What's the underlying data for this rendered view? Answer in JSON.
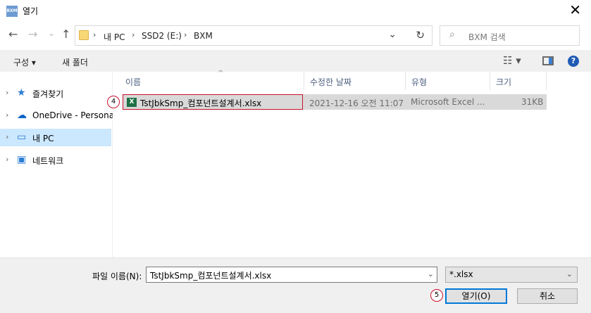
{
  "window": {
    "title": "열기",
    "app_icon_text": "BXM",
    "close_glyph": "✕"
  },
  "nav": {
    "back_glyph": "←",
    "forward_glyph": "→",
    "recent_glyph": "⌄",
    "up_glyph": "↑",
    "breadcrumbs": [
      "내 PC",
      "SSD2 (E:)",
      "BXM"
    ],
    "crumb_sep": "›",
    "dropdown_glyph": "⌄",
    "refresh_glyph": "↻",
    "search_placeholder": "BXM 검색",
    "search_glyph": "⌕"
  },
  "toolbar": {
    "organize": "구성 ▾",
    "new_folder": "새 폴더",
    "view_glyph": "☷ ▾",
    "help_glyph": "?"
  },
  "sidebar": {
    "items": [
      {
        "label": "즐겨찾기",
        "icon": "star-icon",
        "glyph": "★",
        "color": "#2b7cd3"
      },
      {
        "label": "OneDrive - Personal",
        "icon": "cloud-icon",
        "glyph": "☁",
        "color": "#0a64c8"
      },
      {
        "label": "내 PC",
        "icon": "computer-icon",
        "glyph": "▭",
        "color": "#2b7cd3"
      },
      {
        "label": "네트워크",
        "icon": "network-icon",
        "glyph": "▣",
        "color": "#2b7cd3"
      }
    ],
    "chevron": "›"
  },
  "columns": {
    "name": "이름",
    "modified": "수정한 날짜",
    "type": "유형",
    "size": "크기",
    "sort_glyph": "^"
  },
  "files": [
    {
      "name": "TstJbkSmp_컴포넌트설계서.xlsx",
      "modified": "2021-12-16 오전 11:07",
      "type": "Microsoft Excel ...",
      "size": "31KB",
      "icon_text": "X"
    }
  ],
  "steps": {
    "file_marker": "4",
    "open_marker": "5"
  },
  "footer": {
    "filename_label": "파일 이름(N):",
    "filename_value": "TstJbkSmp_컴포넌트설계서.xlsx",
    "filetype_value": "*.xlsx",
    "dropdown_glyph": "⌄",
    "open_button": "열기(O)",
    "cancel_button": "취소"
  },
  "colors": {
    "selection": "#cce8ff",
    "highlight_border": "#c8102e",
    "primary_border": "#0078d7",
    "excel_green": "#1e7145"
  }
}
